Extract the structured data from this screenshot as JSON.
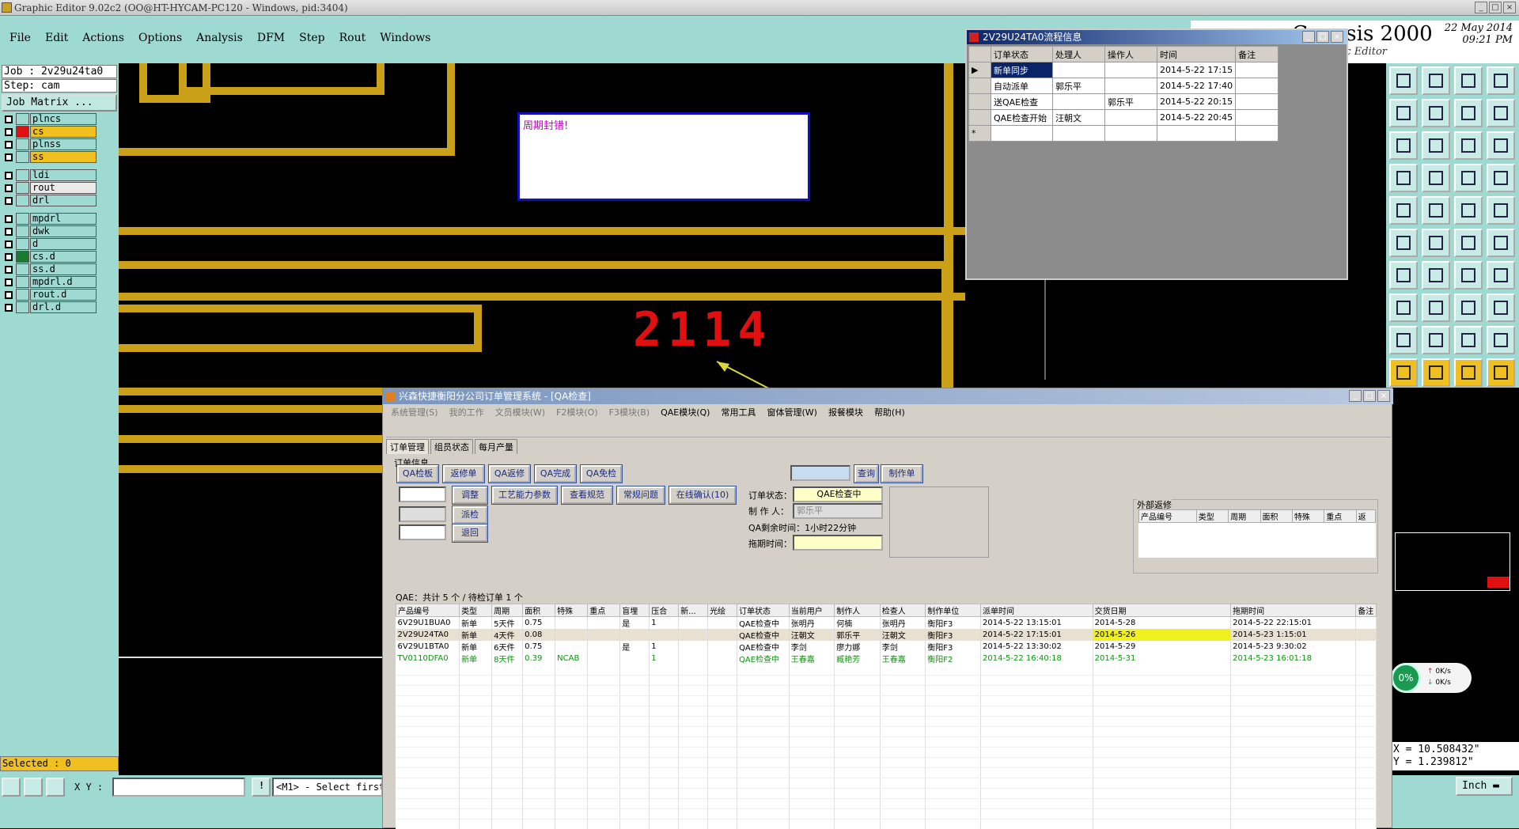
{
  "window": {
    "title": "Graphic Editor 9.02c2 (OO@HT-HYCAM-PC120 - Windows, pid:3404)"
  },
  "menu": [
    "File",
    "Edit",
    "Actions",
    "Options",
    "Analysis",
    "DFM",
    "Step",
    "Rout",
    "Windows"
  ],
  "genesis": {
    "brand": "Genesis 2000",
    "subtitle": "Graphic Editor",
    "date": "22 May 2014",
    "time": "09:21 PM"
  },
  "job": {
    "job_line": "Job : 2v29u24ta0",
    "step_line": "Step: cam",
    "matrix_button": "Job Matrix ..."
  },
  "layers": [
    {
      "name": "plncs",
      "color": "#9fdad2",
      "bg": "#9fdad2",
      "group": 1
    },
    {
      "name": "cs",
      "color": "#e01010",
      "bg": "#f0c020",
      "group": 1
    },
    {
      "name": "plnss",
      "color": "#9fdad2",
      "bg": "#9fdad2",
      "group": 1
    },
    {
      "name": "ss",
      "color": "#9fdad2",
      "bg": "#f0c020",
      "group": 1
    },
    {
      "name": "ldi",
      "color": "#9fdad2",
      "bg": "#9fdad2",
      "group": 2
    },
    {
      "name": "rout",
      "color": "#9fdad2",
      "bg": "#eaeaea",
      "group": 2
    },
    {
      "name": "drl",
      "color": "#9fdad2",
      "bg": "#9fdad2",
      "group": 2
    },
    {
      "name": "mpdrl",
      "color": "#9fdad2",
      "bg": "#9fdad2",
      "group": 3
    },
    {
      "name": "dwk",
      "color": "#9fdad2",
      "bg": "#9fdad2",
      "group": 3
    },
    {
      "name": "d",
      "color": "#9fdad2",
      "bg": "#9fdad2",
      "group": 3
    },
    {
      "name": "cs.d",
      "color": "#1a7a30",
      "bg": "#9fdad2",
      "group": 3
    },
    {
      "name": "ss.d",
      "color": "#9fdad2",
      "bg": "#9fdad2",
      "group": 3
    },
    {
      "name": "mpdrl.d",
      "color": "#9fdad2",
      "bg": "#9fdad2",
      "group": 3
    },
    {
      "name": "rout.d",
      "color": "#9fdad2",
      "bg": "#9fdad2",
      "group": 3
    },
    {
      "name": "drl.d",
      "color": "#9fdad2",
      "bg": "#9fdad2",
      "group": 3
    }
  ],
  "selected": "Selected : 0",
  "xy_label": "X Y :",
  "message": "<M1> - Select first",
  "pcb": {
    "note": "周期封错!",
    "digits": "2114"
  },
  "coords": {
    "x": "X = 10.508432\"",
    "y": "Y = 1.239812\""
  },
  "units": "Inch",
  "network": {
    "percent": "0%",
    "up": "0K/s",
    "down": "0K/s"
  },
  "flow": {
    "title": "2V29U24TA0流程信息",
    "headers": [
      "订单状态",
      "处理人",
      "操作人",
      "时间",
      "备注"
    ],
    "rows": [
      [
        "新单同步",
        "",
        "",
        "2014-5-22 17:15",
        ""
      ],
      [
        "自动派单",
        "郭乐平",
        "",
        "2014-5-22 17:40",
        ""
      ],
      [
        "送QAE检查",
        "",
        "郭乐平",
        "2014-5-22 20:15",
        ""
      ],
      [
        "QAE检查开始",
        "汪朝文",
        "",
        "2014-5-22 20:45",
        ""
      ]
    ]
  },
  "order": {
    "title": "兴森快捷衡阳分公司订单管理系统 - [QA检查]",
    "menu": [
      "系统管理(S)",
      "我的工作",
      "文员模块(W)",
      "F2模块(O)",
      "F3模块(B)",
      "QAE模块(Q)",
      "常用工具",
      "窗体管理(W)",
      "报餐模块",
      "帮助(H)"
    ],
    "tabs": [
      "订单管理",
      "组员状态",
      "每月产量"
    ],
    "group_label": "订单信息",
    "buttons_row1": [
      "QA检板",
      "返修单",
      "QA返修",
      "QA完成",
      "QA免检"
    ],
    "buttons_row2": [
      "调整",
      "工艺能力参数",
      "查看规范",
      "常规问题",
      "在线确认(10)"
    ],
    "button_dispatch": "派检",
    "button_return": "退回",
    "button_query": "查询",
    "button_make": "制作单",
    "status_label": "订单状态：",
    "status_value": "QAE检查中",
    "maker_label": "制 作 人：",
    "maker_value": "郭乐平",
    "remain_label": "QA剩余时间：1小时22分钟",
    "delay_label": "拖期时间：",
    "external_label": "外部返修",
    "external_headers": [
      "产品编号",
      "类型",
      "周期",
      "面积",
      "特殊",
      "重点",
      "返"
    ],
    "summary": "QAE：共计 5 个 / 待检订单 1 个",
    "headers": [
      "产品编号",
      "类型",
      "周期",
      "面积",
      "特殊",
      "重点",
      "盲埋",
      "压合",
      "新...",
      "光绘",
      "订单状态",
      "当前用户",
      "制作人",
      "检查人",
      "制作单位",
      "派单时间",
      "交货日期",
      "拖期时间",
      "备注"
    ],
    "rows": [
      [
        "6V29U1BUA0",
        "新单",
        "5天件",
        "0.75",
        "",
        "",
        "是",
        "1",
        "",
        "",
        "QAE检查中",
        "张明丹",
        "何楠",
        "张明丹",
        "衡阳F3",
        "2014-5-22 13:15:01",
        "2014-5-28",
        "2014-5-22 22:15:01",
        ""
      ],
      [
        "2V29U24TA0",
        "新单",
        "4天件",
        "0.08",
        "",
        "",
        "",
        "",
        "",
        "",
        "QAE检查中",
        "汪朝文",
        "郭乐平",
        "汪朝文",
        "衡阳F3",
        "2014-5-22 17:15:01",
        "2014-5-26",
        "2014-5-23 1:15:01",
        ""
      ],
      [
        "6V29U1BTA0",
        "新单",
        "6天件",
        "0.75",
        "",
        "",
        "是",
        "1",
        "",
        "",
        "QAE检查中",
        "李剑",
        "廖力娜",
        "李剑",
        "衡阳F3",
        "2014-5-22 13:30:02",
        "2014-5-29",
        "2014-5-23 9:30:02",
        ""
      ],
      [
        "TV0110DFA0",
        "新单",
        "8天件",
        "0.39",
        "NCAB",
        "",
        "",
        "1",
        "",
        "",
        "QAE检查中",
        "王春嘉",
        "臧艳芳",
        "王春嘉",
        "衡阳F2",
        "2014-5-22 16:40:18",
        "2014-5-31",
        "2014-5-23 16:01:18",
        ""
      ]
    ]
  }
}
